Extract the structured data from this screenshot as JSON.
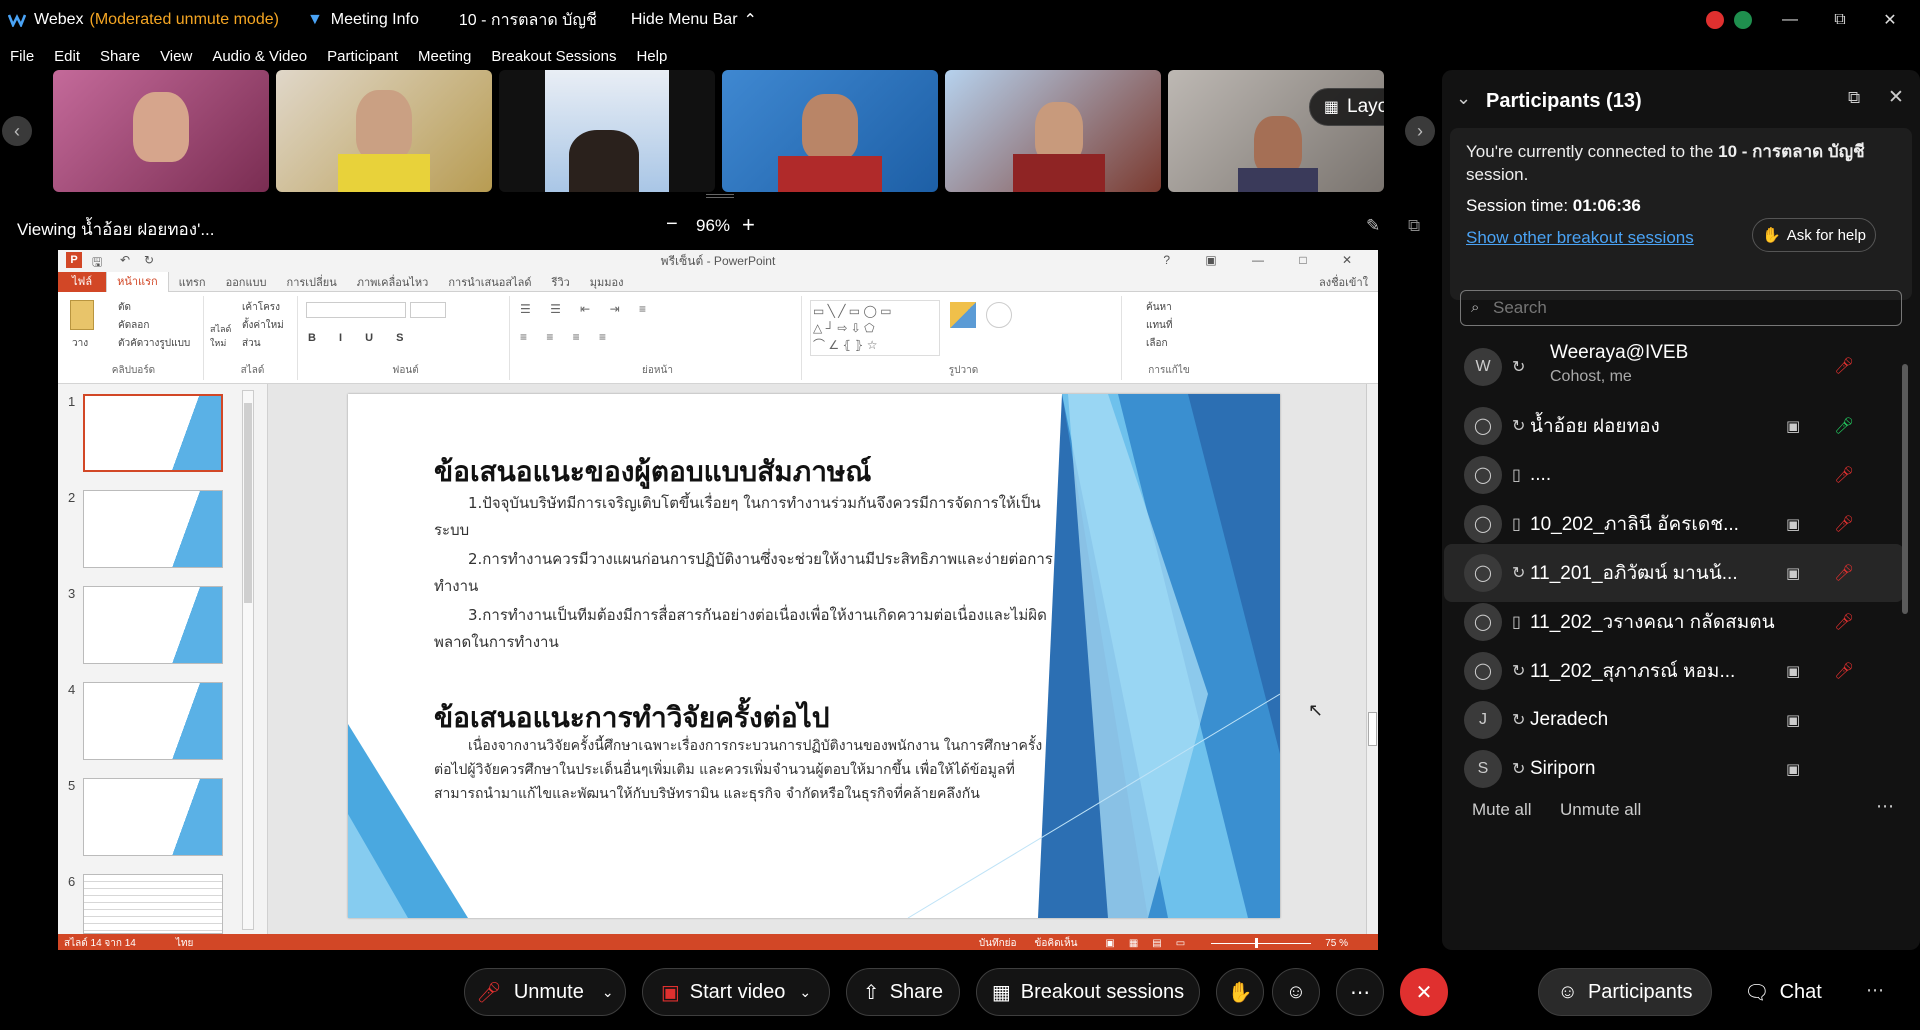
{
  "app": {
    "name": "Webex",
    "mode": "(Moderated unmute mode)",
    "meeting_info": "Meeting Info",
    "session_title": "10 - การตลาด บัญชี",
    "hide_menu": "Hide Menu Bar"
  },
  "menu": [
    "File",
    "Edit",
    "Share",
    "View",
    "Audio & Video",
    "Participant",
    "Meeting",
    "Breakout Sessions",
    "Help"
  ],
  "strip": {
    "layout_label": "Layout",
    "thumb_colors": [
      "#b04a7a",
      "#c9a24a",
      "#3a5f9a",
      "#2f6fb6",
      "#8f5540",
      "#6f6a66"
    ]
  },
  "viewing": {
    "label": "Viewing น้ำอ้อย ฝอยทอง'...",
    "zoom": "96%",
    "zoom_out": "−",
    "zoom_in": "+"
  },
  "ppt": {
    "title": "พรีเซ็นต์ - PowerPoint",
    "tabs": [
      "ไฟล์",
      "หน้าแรก",
      "แทรก",
      "ออกแบบ",
      "การเปลี่ยน",
      "ภาพเคลื่อนไหว",
      "การนำเสนอสไลด์",
      "รีวิว",
      "มุมมอง"
    ],
    "signin": "ลงชื่อเข้าใ",
    "ribbon_groups": [
      "คลิปบอร์ด",
      "สไลด์",
      "ฟอนต์",
      "ย่อหน้า",
      "รูปวาด",
      "การแก้ไข"
    ],
    "clipboard": {
      "paste": "วาง",
      "cut": "ตัด",
      "copy": "คัดลอก",
      "format": "ตัวคัดวางรูปแบบ"
    },
    "slides_group": {
      "new": "สไลด์ใหม่",
      "layout": "เค้าโครง",
      "reset": "ตั้งค่าใหม่",
      "section": "ส่วน"
    },
    "editing": {
      "find": "ค้นหา",
      "replace": "แทนที่",
      "select": "เลือก"
    },
    "slide_numbers": [
      "1",
      "2",
      "3",
      "4",
      "5",
      "6"
    ],
    "slide": {
      "heading1": "ข้อเสนอแนะของผู้ตอบแบบสัมภาษณ์",
      "p1": "1.ปัจจุบันบริษัทมีการเจริญเติบโตขึ้นเรื่อยๆ ในการทำงานร่วมกันจึงควรมีการจัดการให้เป็นระบบ",
      "p2": "2.การทำงานควรมีวางแผนก่อนการปฏิบัติงานซึ่งจะช่วยให้งานมีประสิทธิภาพและง่ายต่อการทำงาน",
      "p3": "3.การทำงานเป็นทีมต้องมีการสื่อสารกันอย่างต่อเนื่องเพื่อให้งานเกิดความต่อเนื่องและไม่ผิดพลาดในการทำงาน",
      "heading2": "ข้อเสนอแนะการทำวิจัยครั้งต่อไป",
      "p4": "เนื่องจากงานวิจัยครั้งนี้ศึกษาเฉพาะเรื่องการกระบวนการปฏิบัติงานของพนักงาน ในการศึกษาครั้งต่อไปผู้วิจัยควรศึกษาในประเด็นอื่นๆเพิ่มเติม และควรเพิ่มจำนวนผู้ตอบให้มากขึ้น เพื่อให้ได้ข้อมูลที่สามารถนำมาแก้ไขและพัฒนาให้กับบริษัทรามิน และธุรกิจ จำกัดหรือในธุรกิจที่คล้ายคลึงกัน"
    },
    "status": {
      "slide_count": "สไลด์ 14 จาก 14",
      "lang": "ไทย",
      "notes": "บันทึกย่อ",
      "comments": "ข้อคิดเห็น",
      "zoom": "75 %"
    }
  },
  "panel": {
    "title": "Participants (13)",
    "connected_prefix": "You're currently connected to the",
    "connected_session": "10 - การตลาด บัญชี",
    "connected_suffix": "session.",
    "session_time_label": "Session time:",
    "session_time": "01:06:36",
    "show_other": "Show other breakout sessions",
    "ask_help": "Ask for help",
    "search_placeholder": "Search",
    "participants": [
      {
        "initial": "W",
        "name": "Weeraya@IVEB",
        "sub": "Cohost, me",
        "device": "sync",
        "video": false,
        "mic": "muted"
      },
      {
        "initial": "",
        "name": "น้ำอ้อย ฝอยทอง",
        "sub": "",
        "device": "sync",
        "video": true,
        "mic": "active"
      },
      {
        "initial": "",
        "name": "....",
        "sub": "",
        "device": "phone",
        "video": false,
        "mic": "muted"
      },
      {
        "initial": "",
        "name": "10_202_ภาลินี อัครเดช...",
        "sub": "",
        "device": "phone",
        "video": true,
        "mic": "muted"
      },
      {
        "initial": "",
        "name": "11_201_อภิวัฒน์ มานน้...",
        "sub": "",
        "device": "sync",
        "video": true,
        "mic": "muted"
      },
      {
        "initial": "",
        "name": "11_202_วรางคณา กลัดสมตน",
        "sub": "",
        "device": "phone",
        "video": false,
        "mic": "muted"
      },
      {
        "initial": "",
        "name": "11_202_สุภาภรณ์ หอม...",
        "sub": "",
        "device": "sync",
        "video": true,
        "mic": "muted"
      },
      {
        "initial": "J",
        "name": "Jeradech",
        "sub": "",
        "device": "sync",
        "video": true,
        "mic": "none"
      },
      {
        "initial": "S",
        "name": "Siriporn",
        "sub": "",
        "device": "sync",
        "video": true,
        "mic": "none"
      }
    ],
    "mute_all": "Mute all",
    "unmute_all": "Unmute all"
  },
  "bottom": {
    "unmute": "Unmute",
    "start_video": "Start video",
    "share": "Share",
    "breakout": "Breakout sessions",
    "participants": "Participants",
    "chat": "Chat"
  },
  "colors": {
    "accent_blue": "#4aa3f5",
    "moderated_orange": "#f5a623",
    "mute_red": "#e0302f",
    "leave_red": "#e0302f",
    "ppt_red": "#d24726",
    "mic_green": "#22c55e"
  }
}
